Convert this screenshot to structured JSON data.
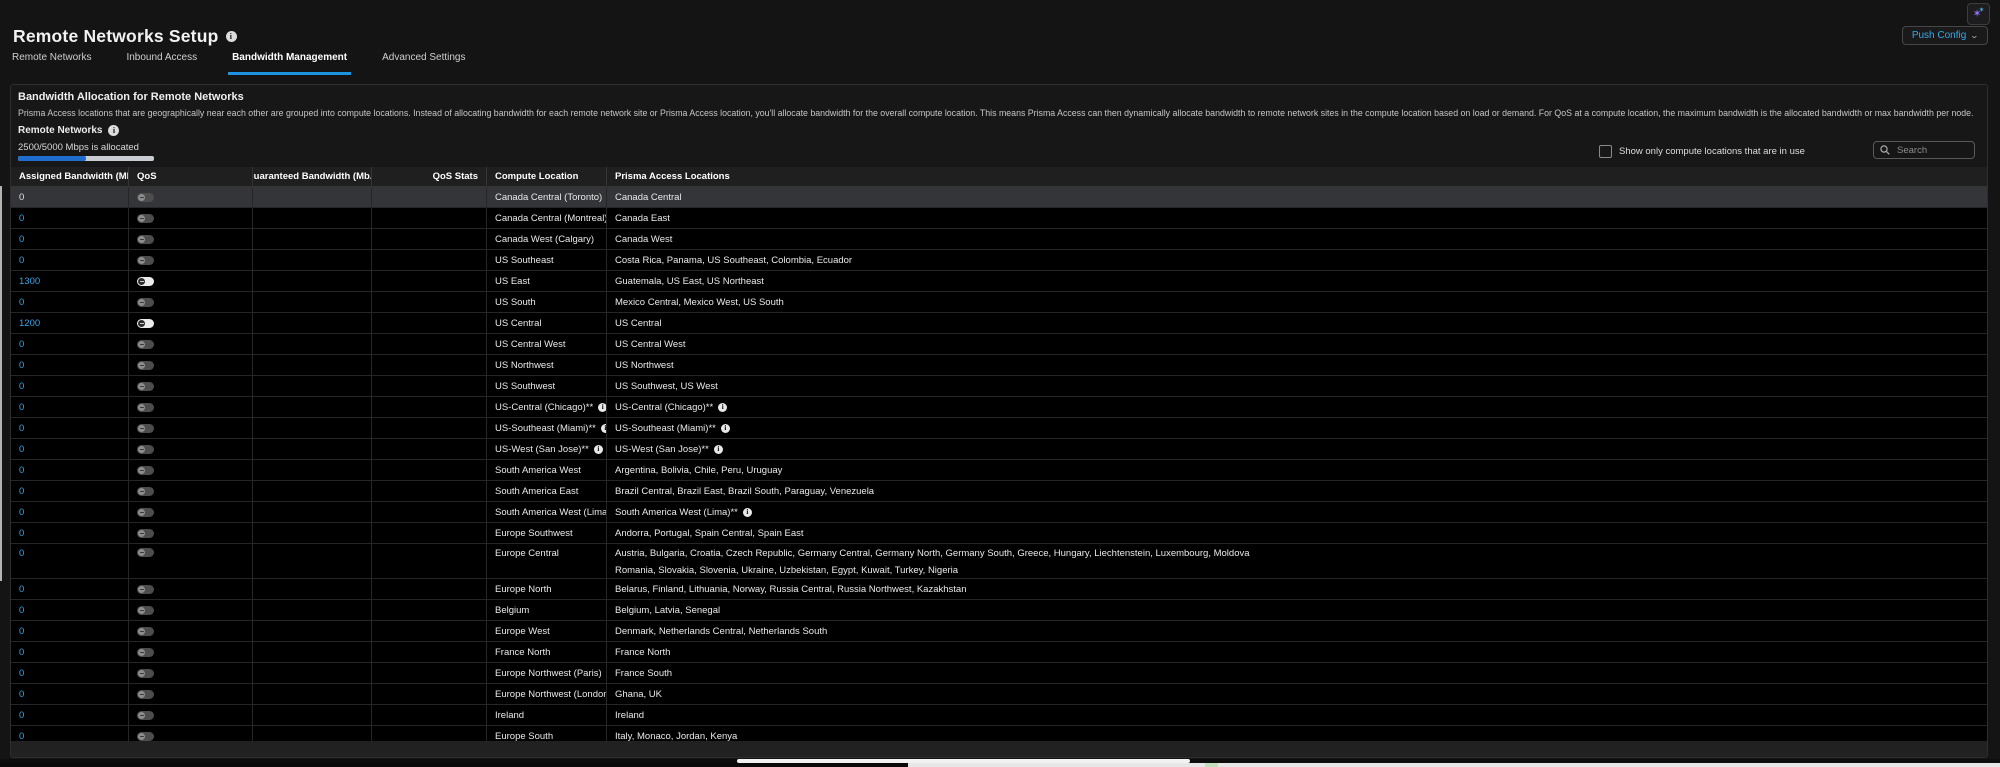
{
  "app": {
    "title": "Remote Networks Setup",
    "push_config_label": "Push Config",
    "icons": {
      "title_info": "info-icon",
      "copilot": "sparkles-icon",
      "push_config_chevron": "chevron-down-icon"
    }
  },
  "tabs": [
    {
      "label": "Remote Networks",
      "active": false
    },
    {
      "label": "Inbound Access",
      "active": false
    },
    {
      "label": "Bandwidth Management",
      "active": true
    },
    {
      "label": "Advanced Settings",
      "active": false
    }
  ],
  "section": {
    "title": "Bandwidth Allocation for Remote Networks",
    "description": "Prisma Access locations that are geographically near each other are grouped into compute locations. Instead of allocating bandwidth for each remote network site or Prisma Access location, you'll allocate bandwidth for the overall compute location. This means Prisma Access can then dynamically allocate bandwidth to remote network sites in the compute location based on load or demand. For QoS at a compute location, the maximum bandwidth is the allocated bandwidth or max bandwidth per node."
  },
  "allocation": {
    "label": "Remote Networks",
    "status": "2500/5000 Mbps is allocated",
    "allocated_mbps": 2500,
    "total_mbps": 5000,
    "percent": 50
  },
  "filters": {
    "checkbox_label": "Show only compute locations that are in use",
    "checkbox_checked": false,
    "search_placeholder": "Search"
  },
  "colors": {
    "tab_underline": "#1e93e0",
    "link_blue": "#3ba2e3",
    "progress_fill": "#1f6ece",
    "selected_row": "#333538"
  },
  "table": {
    "columns": [
      "Assigned Bandwidth (Mbps)",
      "QoS",
      "Guaranteed Bandwidth (Mb...",
      "QoS Stats",
      "Compute Location",
      "Prisma Access Locations"
    ],
    "rows": [
      {
        "assigned": "0",
        "is_link": false,
        "selected": true,
        "qos_enabled": false,
        "compute": "Canada Central (Toronto)",
        "prisma": "Canada Central"
      },
      {
        "assigned": "0",
        "qos_enabled": false,
        "compute": "Canada Central (Montreal)",
        "prisma": "Canada East"
      },
      {
        "assigned": "0",
        "qos_enabled": false,
        "compute": "Canada West (Calgary)",
        "prisma": "Canada West"
      },
      {
        "assigned": "0",
        "qos_enabled": false,
        "compute": "US Southeast",
        "prisma": "Costa Rica, Panama, US Southeast, Colombia, Ecuador"
      },
      {
        "assigned": "1300",
        "qos_enabled": true,
        "compute": "US East",
        "prisma": "Guatemala, US East, US Northeast"
      },
      {
        "assigned": "0",
        "qos_enabled": false,
        "compute": "US South",
        "prisma": "Mexico Central, Mexico West, US South"
      },
      {
        "assigned": "1200",
        "qos_enabled": true,
        "compute": "US Central",
        "prisma": "US Central"
      },
      {
        "assigned": "0",
        "qos_enabled": false,
        "compute": "US Central West",
        "prisma": "US Central West"
      },
      {
        "assigned": "0",
        "qos_enabled": false,
        "compute": "US Northwest",
        "prisma": "US Northwest"
      },
      {
        "assigned": "0",
        "qos_enabled": false,
        "compute": "US Southwest",
        "prisma": "US Southwest, US West"
      },
      {
        "assigned": "0",
        "qos_enabled": false,
        "compute": "US-Central (Chicago)**",
        "compute_info": true,
        "prisma": "US-Central (Chicago)**",
        "prisma_info": true
      },
      {
        "assigned": "0",
        "qos_enabled": false,
        "compute": "US-Southeast (Miami)**",
        "compute_info": true,
        "prisma": "US-Southeast (Miami)**",
        "prisma_info": true
      },
      {
        "assigned": "0",
        "qos_enabled": false,
        "compute": "US-West (San Jose)**",
        "compute_info": true,
        "prisma": "US-West (San Jose)**",
        "prisma_info": true
      },
      {
        "assigned": "0",
        "qos_enabled": false,
        "compute": "South America West",
        "prisma": "Argentina, Bolivia, Chile, Peru, Uruguay"
      },
      {
        "assigned": "0",
        "qos_enabled": false,
        "compute": "South America East",
        "prisma": "Brazil Central, Brazil East, Brazil South, Paraguay, Venezuela"
      },
      {
        "assigned": "0",
        "qos_enabled": false,
        "compute": "South America West (Lima)**",
        "compute_info": true,
        "prisma": "South America West (Lima)**",
        "prisma_info": true
      },
      {
        "assigned": "0",
        "qos_enabled": false,
        "compute": "Europe Southwest",
        "prisma": "Andorra, Portugal, Spain Central, Spain East"
      },
      {
        "assigned": "0",
        "qos_enabled": false,
        "compute": "Europe Central",
        "prisma": "Austria, Bulgaria, Croatia, Czech Republic, Germany Central, Germany North, Germany South, Greece, Hungary, Liechtenstein, Luxembourg, Moldova",
        "prisma_line2": "Romania, Slovakia, Slovenia, Ukraine, Uzbekistan, Egypt, Kuwait, Turkey, Nigeria"
      },
      {
        "assigned": "0",
        "qos_enabled": false,
        "compute": "Europe North",
        "prisma": "Belarus, Finland, Lithuania, Norway, Russia Central, Russia Northwest, Kazakhstan"
      },
      {
        "assigned": "0",
        "qos_enabled": false,
        "compute": "Belgium",
        "prisma": "Belgium, Latvia, Senegal"
      },
      {
        "assigned": "0",
        "qos_enabled": false,
        "compute": "Europe West",
        "prisma": "Denmark, Netherlands Central, Netherlands South"
      },
      {
        "assigned": "0",
        "qos_enabled": false,
        "compute": "France North",
        "prisma": "France North"
      },
      {
        "assigned": "0",
        "qos_enabled": false,
        "compute": "Europe Northwest (Paris)",
        "prisma": "France South"
      },
      {
        "assigned": "0",
        "qos_enabled": false,
        "compute": "Europe Northwest (London)",
        "prisma": "Ghana, UK"
      },
      {
        "assigned": "0",
        "qos_enabled": false,
        "compute": "Ireland",
        "prisma": "Ireland"
      },
      {
        "assigned": "0",
        "qos_enabled": false,
        "compute": "Europe South",
        "prisma": "Italy, Monaco, Jordan, Kenya"
      }
    ]
  }
}
